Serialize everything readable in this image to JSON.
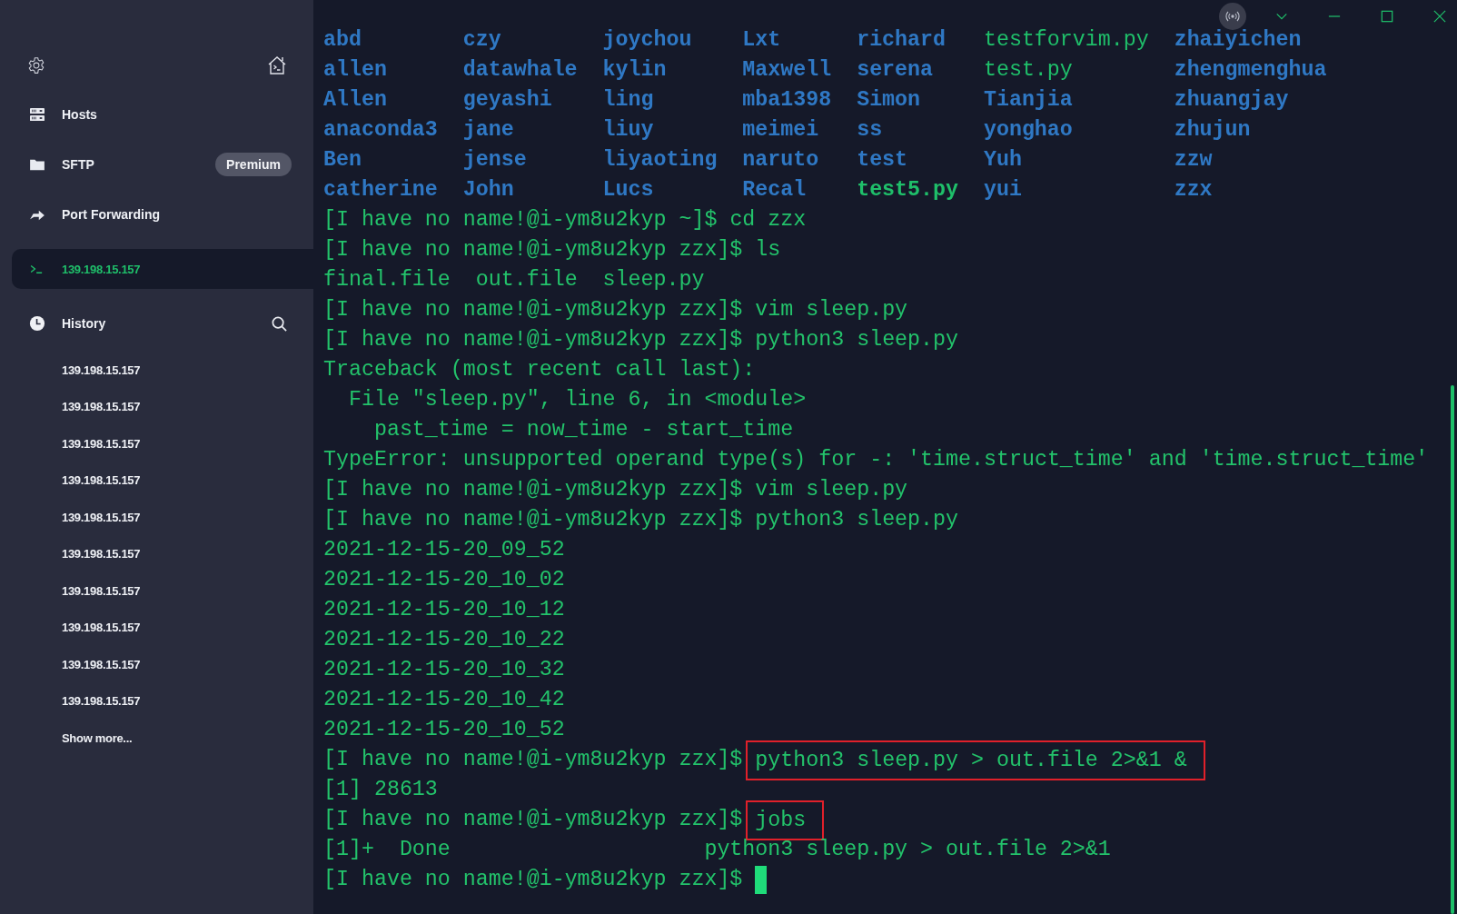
{
  "sidebar": {
    "nav": [
      {
        "label": "Hosts",
        "selected": false
      },
      {
        "label": "SFTP",
        "badge": "Premium",
        "selected": false
      },
      {
        "label": "Port Forwarding",
        "selected": false
      }
    ],
    "session": {
      "label": "139.198.15.157",
      "selected": true
    },
    "history": {
      "title": "History",
      "items": [
        "139.198.15.157",
        "139.198.15.157",
        "139.198.15.157",
        "139.198.15.157",
        "139.198.15.157",
        "139.198.15.157",
        "139.198.15.157",
        "139.198.15.157",
        "139.198.15.157",
        "139.198.15.157"
      ],
      "show_more": "Show more..."
    }
  },
  "terminal": {
    "listing": [
      [
        {
          "name": "abd",
          "kind": "dir"
        },
        {
          "name": "czy",
          "kind": "dir"
        },
        {
          "name": "joychou",
          "kind": "dir"
        },
        {
          "name": "Lxt",
          "kind": "dir"
        },
        {
          "name": "richard",
          "kind": "dir"
        },
        {
          "name": "testforvim.py",
          "kind": "script"
        },
        {
          "name": "zhaiyichen",
          "kind": "dir"
        }
      ],
      [
        {
          "name": "allen",
          "kind": "dir"
        },
        {
          "name": "datawhale",
          "kind": "dir"
        },
        {
          "name": "kylin",
          "kind": "dir"
        },
        {
          "name": "Maxwell",
          "kind": "dir"
        },
        {
          "name": "serena",
          "kind": "dir"
        },
        {
          "name": "test.py",
          "kind": "script"
        },
        {
          "name": "zhengmenghua",
          "kind": "dir"
        }
      ],
      [
        {
          "name": "Allen",
          "kind": "dir"
        },
        {
          "name": "geyashi",
          "kind": "dir"
        },
        {
          "name": "ling",
          "kind": "dir"
        },
        {
          "name": "mba1398",
          "kind": "dir"
        },
        {
          "name": "Simon",
          "kind": "dir"
        },
        {
          "name": "Tianjia",
          "kind": "dir"
        },
        {
          "name": "zhuangjay",
          "kind": "dir"
        }
      ],
      [
        {
          "name": "anaconda3",
          "kind": "dir"
        },
        {
          "name": "jane",
          "kind": "dir"
        },
        {
          "name": "liuy",
          "kind": "dir"
        },
        {
          "name": "meimei",
          "kind": "dir"
        },
        {
          "name": "ss",
          "kind": "dir"
        },
        {
          "name": "yonghao",
          "kind": "dir"
        },
        {
          "name": "zhujun",
          "kind": "dir"
        }
      ],
      [
        {
          "name": "Ben",
          "kind": "dir"
        },
        {
          "name": "jense",
          "kind": "dir"
        },
        {
          "name": "liyaoting",
          "kind": "dir"
        },
        {
          "name": "naruto",
          "kind": "dir"
        },
        {
          "name": "test",
          "kind": "dir"
        },
        {
          "name": "Yuh",
          "kind": "dir"
        },
        {
          "name": "zzw",
          "kind": "dir"
        }
      ],
      [
        {
          "name": "catherine",
          "kind": "dir"
        },
        {
          "name": "John",
          "kind": "dir"
        },
        {
          "name": "Lucs",
          "kind": "dir"
        },
        {
          "name": "Recal",
          "kind": "dir"
        },
        {
          "name": "test5.py",
          "kind": "exec"
        },
        {
          "name": "yui",
          "kind": "dir"
        },
        {
          "name": "zzx",
          "kind": "dir"
        }
      ]
    ],
    "lines": [
      {
        "kind": "prompt",
        "prompt": "[I have no name!@i-ym8u2kyp ~]$",
        "command": "cd zzx"
      },
      {
        "kind": "prompt",
        "prompt": "[I have no name!@i-ym8u2kyp zzx]$",
        "command": "ls"
      },
      {
        "kind": "output",
        "text": "final.file  out.file  sleep.py"
      },
      {
        "kind": "prompt",
        "prompt": "[I have no name!@i-ym8u2kyp zzx]$",
        "command": "vim sleep.py"
      },
      {
        "kind": "prompt",
        "prompt": "[I have no name!@i-ym8u2kyp zzx]$",
        "command": "python3 sleep.py"
      },
      {
        "kind": "output",
        "text": "Traceback (most recent call last):"
      },
      {
        "kind": "output",
        "text": "  File \"sleep.py\", line 6, in <module>"
      },
      {
        "kind": "output",
        "text": "    past_time = now_time - start_time"
      },
      {
        "kind": "output",
        "text": "TypeError: unsupported operand type(s) for -: 'time.struct_time' and 'time.struct_time'"
      },
      {
        "kind": "prompt",
        "prompt": "[I have no name!@i-ym8u2kyp zzx]$",
        "command": "vim sleep.py"
      },
      {
        "kind": "prompt",
        "prompt": "[I have no name!@i-ym8u2kyp zzx]$",
        "command": "python3 sleep.py"
      },
      {
        "kind": "output",
        "text": "2021-12-15-20_09_52"
      },
      {
        "kind": "output",
        "text": "2021-12-15-20_10_02"
      },
      {
        "kind": "output",
        "text": "2021-12-15-20_10_12"
      },
      {
        "kind": "output",
        "text": "2021-12-15-20_10_22"
      },
      {
        "kind": "output",
        "text": "2021-12-15-20_10_32"
      },
      {
        "kind": "output",
        "text": "2021-12-15-20_10_42"
      },
      {
        "kind": "output",
        "text": "2021-12-15-20_10_52"
      },
      {
        "kind": "prompt",
        "prompt": "[I have no name!@i-ym8u2kyp zzx]$",
        "command": "python3 sleep.py > out.file 2>&1 &",
        "boxed": true
      },
      {
        "kind": "output",
        "text": "[1] 28613"
      },
      {
        "kind": "prompt",
        "prompt": "[I have no name!@i-ym8u2kyp zzx]$",
        "command": "jobs",
        "boxed": true
      },
      {
        "kind": "output",
        "text": "[1]+  Done                    python3 sleep.py > out.file 2>&1"
      },
      {
        "kind": "prompt",
        "prompt": "[I have no name!@i-ym8u2kyp zzx]$",
        "cursor": true
      }
    ]
  }
}
